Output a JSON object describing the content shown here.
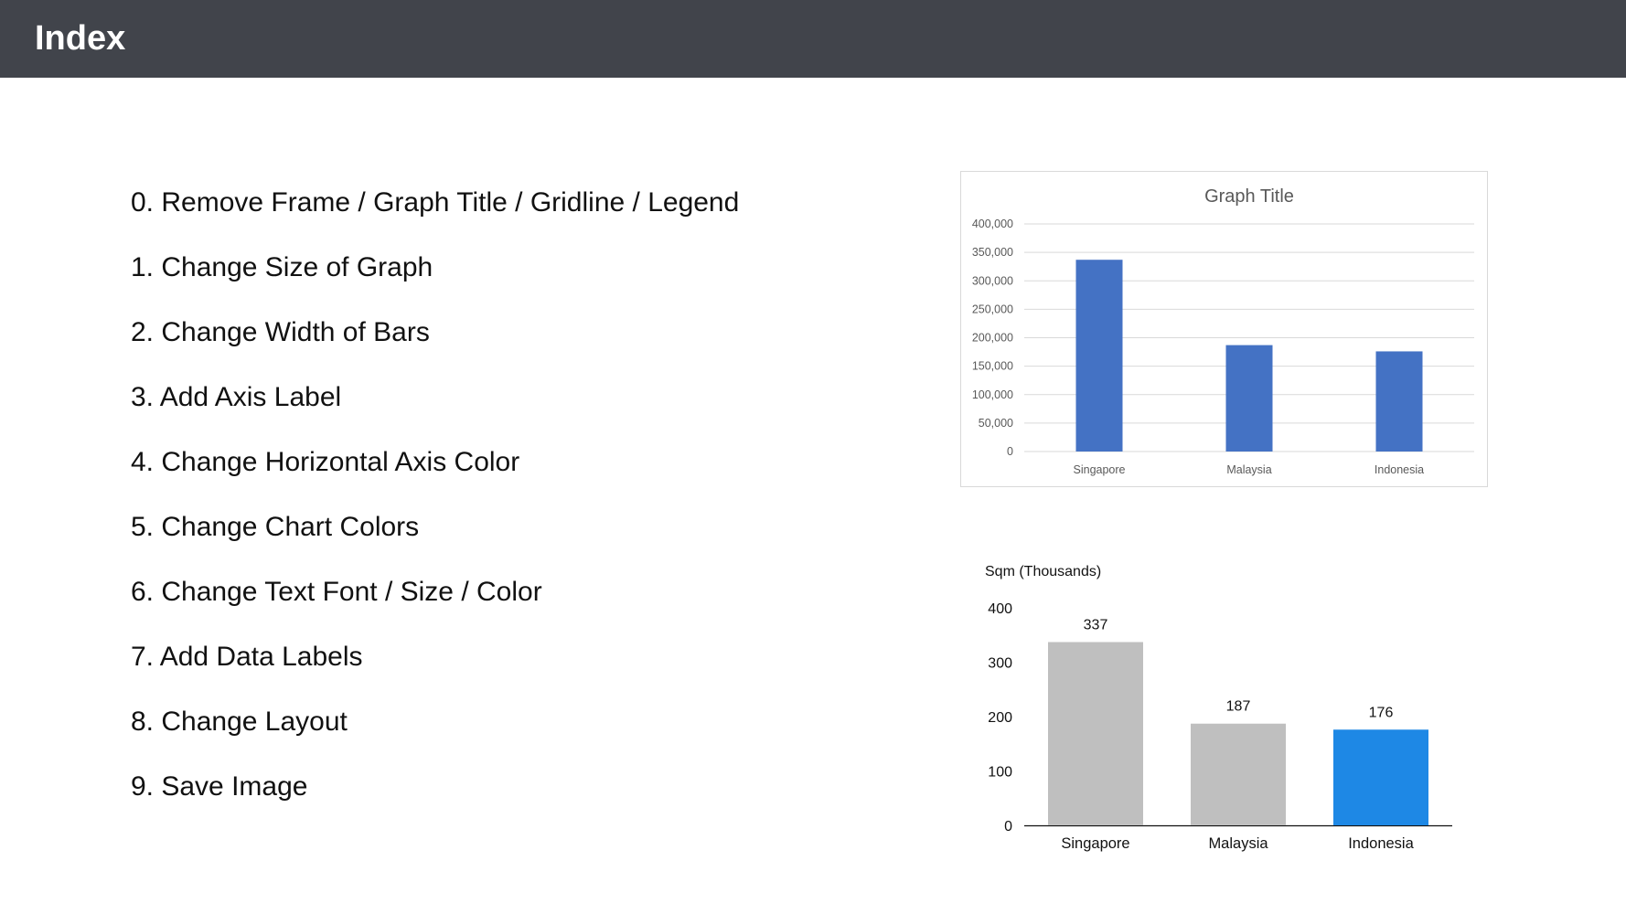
{
  "header": {
    "title": "Index"
  },
  "index_items": [
    "0. Remove Frame / Graph Title / Gridline / Legend",
    "1. Change Size of Graph",
    "2. Change Width of Bars",
    "3. Add Axis Label",
    "4. Change Horizontal Axis Color",
    "5. Change Chart Colors",
    "6. Change Text Font / Size / Color",
    "7. Add Data Labels",
    "8. Change Layout",
    "9. Save Image"
  ],
  "colors": {
    "header_bg": "#41444b",
    "original_bar": "#4472c4",
    "styled_bar": "#bfbfbf",
    "styled_highlight": "#1e88e5"
  },
  "chart_data": [
    {
      "type": "bar",
      "title": "Graph Title",
      "categories": [
        "Singapore",
        "Malaysia",
        "Indonesia"
      ],
      "values": [
        337000,
        187000,
        176000
      ],
      "ylim": [
        0,
        400000
      ],
      "yticks": [
        "0",
        "50,000",
        "100,000",
        "150,000",
        "200,000",
        "250,000",
        "300,000",
        "350,000",
        "400,000"
      ],
      "ytick_values": [
        0,
        50000,
        100000,
        150000,
        200000,
        250000,
        300000,
        350000,
        400000
      ],
      "xlabel": "",
      "ylabel": "",
      "grid": true,
      "frame": true
    },
    {
      "type": "bar",
      "title": "",
      "categories": [
        "Singapore",
        "Malaysia",
        "Indonesia"
      ],
      "values": [
        337,
        187,
        176
      ],
      "data_labels": [
        "337",
        "187",
        "176"
      ],
      "highlight": "Indonesia",
      "ylim": [
        0,
        400
      ],
      "yticks": [
        "0",
        "100",
        "200",
        "300",
        "400"
      ],
      "ytick_values": [
        0,
        100,
        200,
        300,
        400
      ],
      "xlabel": "",
      "ylabel": "Sqm (Thousands)",
      "grid": false,
      "frame": false
    }
  ]
}
